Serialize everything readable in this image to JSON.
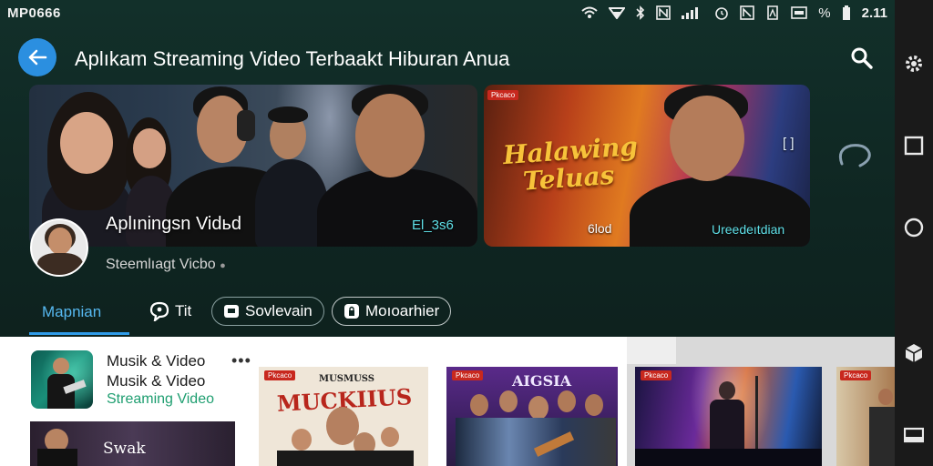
{
  "status": {
    "carrier": "MP0666",
    "time": "2.11",
    "battery_text": "%"
  },
  "appbar": {
    "title": "Aplıkam Streaming Video Terbaakt Hiburan Anua"
  },
  "hero": {
    "card1": {
      "label": "Aplıningsn Vidьd",
      "badge": "El_3s6"
    },
    "card2": {
      "tag": "Pkcaco",
      "script_title_line1": "Halawing",
      "script_title_line2": "Teluas",
      "bottom_left": "6lod",
      "bottom_right": "Ureedeıtdian",
      "corner_mark": "[ ]"
    }
  },
  "channel": {
    "subtitle": "Steemlıagt Vicbo"
  },
  "tabs": [
    {
      "label": "Mapnian",
      "active": true
    },
    {
      "label": "Tit",
      "icon": "chat-bubble-icon"
    },
    {
      "label": "Sovlevain",
      "icon": "screen-icon"
    },
    {
      "label": "Moıoarhier",
      "icon": "lock-icon"
    }
  ],
  "list": {
    "line1": "Musik & Video",
    "line2": "Musik & Video",
    "line3": "Streaming Video",
    "more": "•••"
  },
  "cards": {
    "small_label": "Swak",
    "card1_heading": "MUSMUSS",
    "card1_title": "MUCKIIUS",
    "card2_title": "AIGSIA",
    "tag": "Pkcaco"
  },
  "colors": {
    "accent": "#2b8fe0",
    "active_tab": "#56b8f0",
    "green_text": "#1e9e70",
    "hero_badge": "#5fe0e8"
  }
}
